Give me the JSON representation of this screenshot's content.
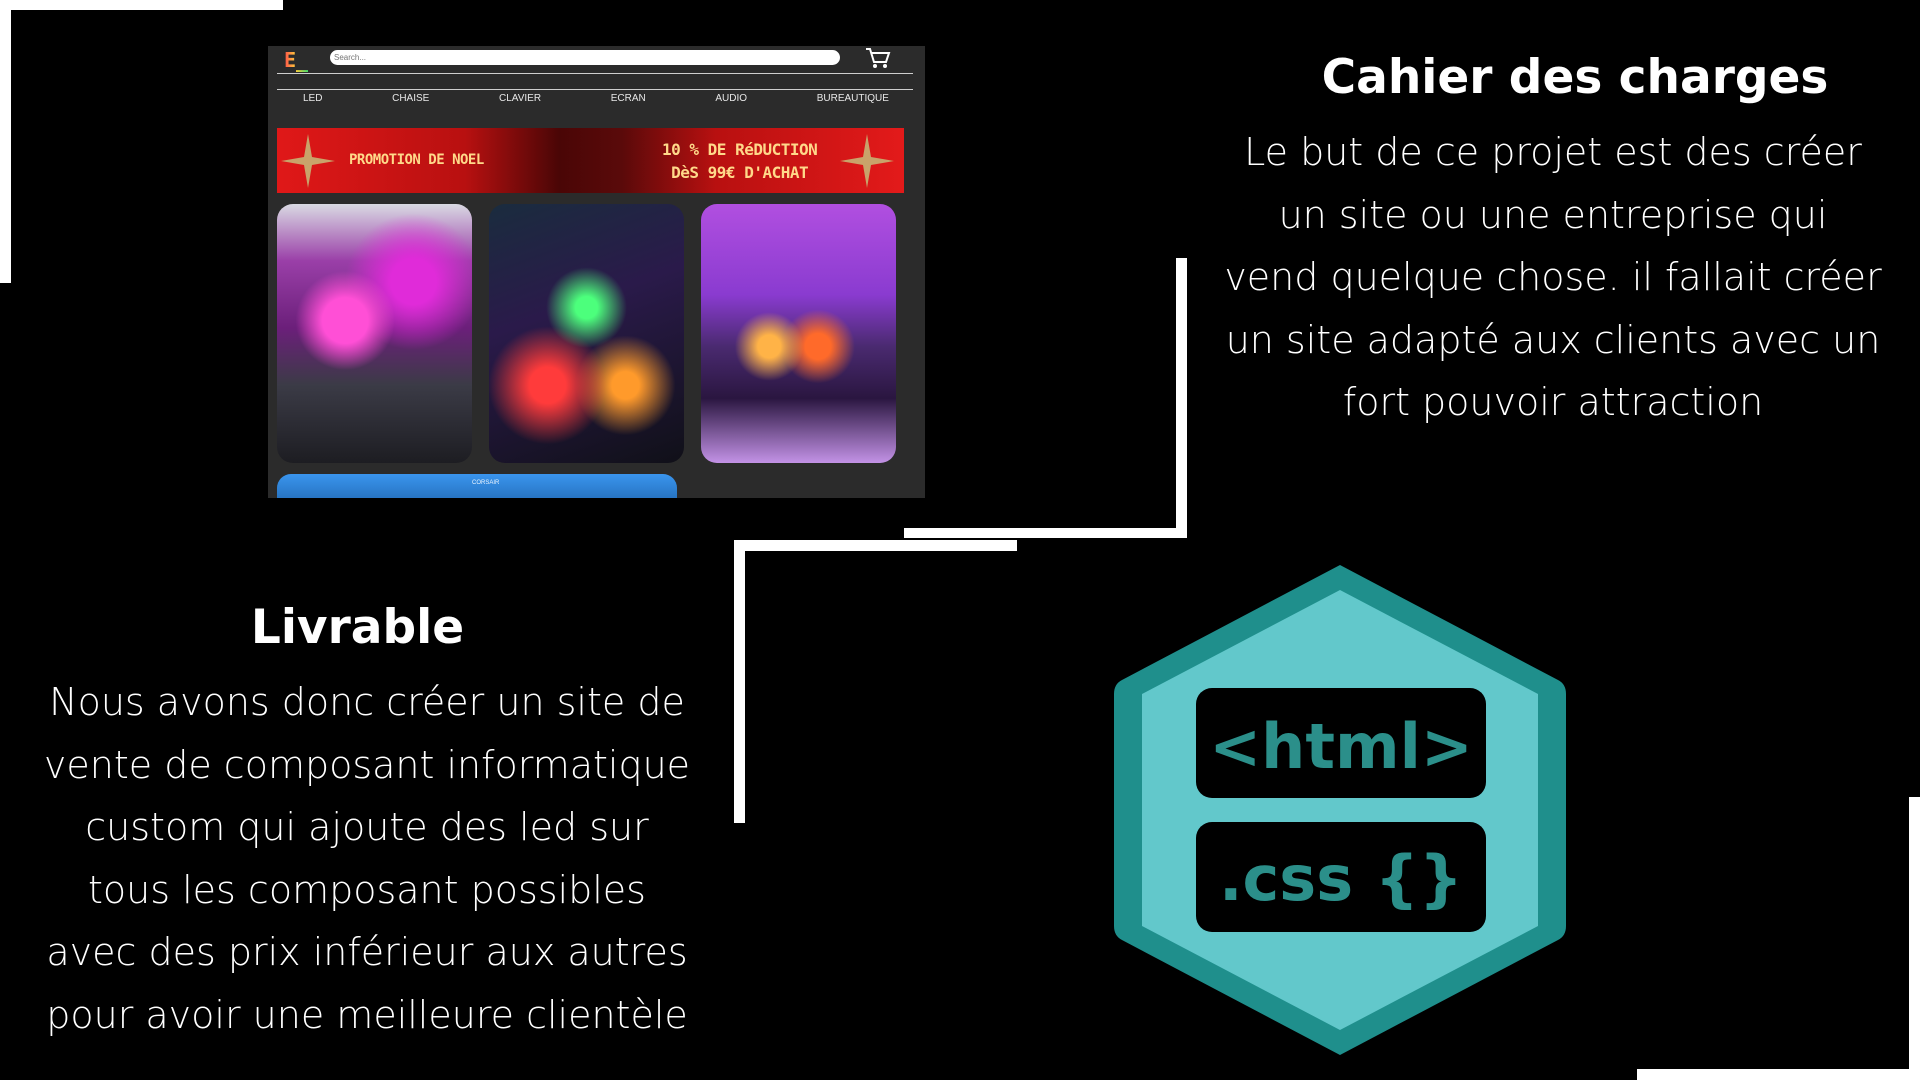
{
  "mockup": {
    "logo_text": "E_",
    "search_placeholder": "Search...",
    "nav": [
      "LED",
      "CHAISE",
      "CLAVIER",
      "ECRAN",
      "AUDIO",
      "BUREAUTIQUE"
    ],
    "banner": {
      "left_text": "PROMOTION DE NOEL",
      "right_line1": "10 % DE RéDUCTION",
      "right_line2": "DèS 99€ D'ACHAT"
    },
    "bottom_brand": "CORSAIR"
  },
  "cahier": {
    "title": "Cahier des charges",
    "lines": [
      "Le but de ce projet est des créer",
      "un site ou une entreprise qui",
      "vend quelque chose. il fallait créer",
      "un site adapté aux clients avec un",
      "fort pouvoir attraction"
    ]
  },
  "livrable": {
    "title": "Livrable",
    "lines": [
      "Nous avons donc créer un site de",
      "vente de composant informatique",
      "custom qui ajoute des led sur",
      "tous les composant possibles",
      "avec des prix inférieur aux autres",
      "pour avoir une meilleure clientèle"
    ]
  },
  "badge": {
    "html_label": "<html>",
    "css_label": ".css {}"
  },
  "colors": {
    "badge_outer": "#1f8f8c",
    "badge_inner": "#62c8cb",
    "badge_label_bg": "#000000",
    "badge_label_text": "#2b8f8a",
    "banner_red": "#e01818"
  }
}
